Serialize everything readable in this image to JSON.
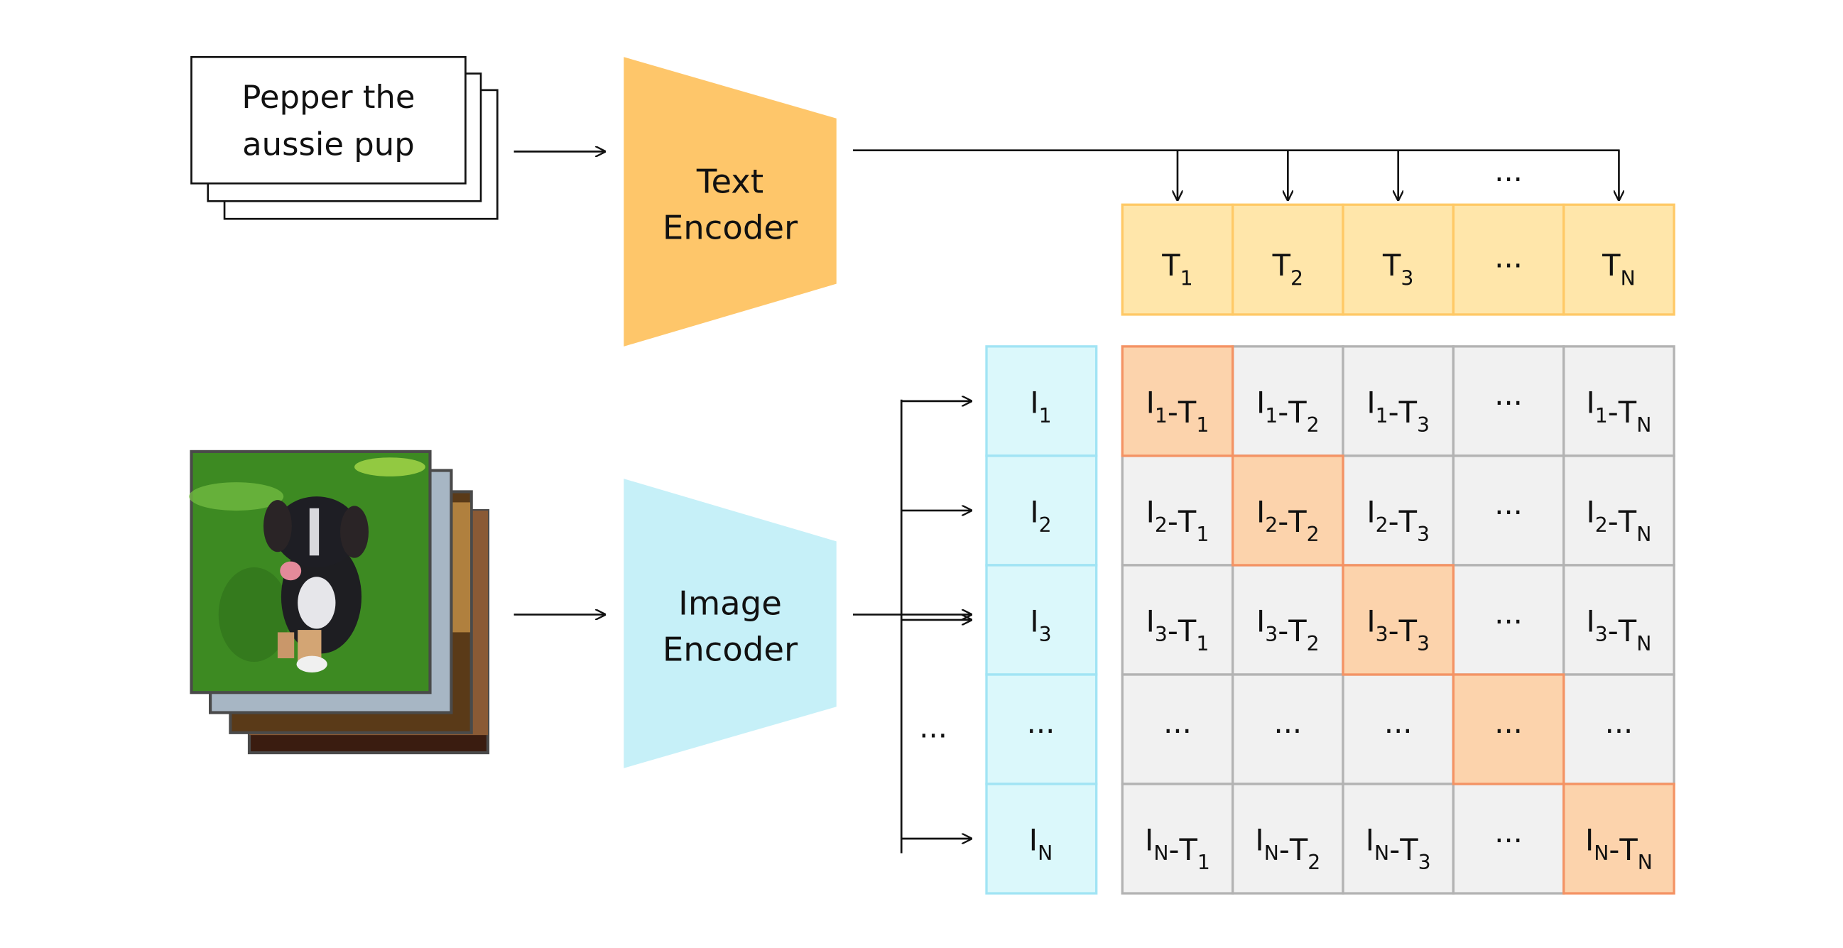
{
  "text_input": {
    "caption_line1": "Pepper the",
    "caption_line2": "aussie pup"
  },
  "text_encoder": {
    "line1": "Text",
    "line2": "Encoder",
    "color": "#FEC66A"
  },
  "image_encoder": {
    "line1": "Image",
    "line2": "Encoder",
    "color": "#C6F0F8"
  },
  "ellipsis": "...",
  "text_embeddings": {
    "fill": "#FFE6AA",
    "stroke": "#FFC966",
    "items": [
      {
        "base": "T",
        "sub": "1"
      },
      {
        "base": "T",
        "sub": "2"
      },
      {
        "base": "T",
        "sub": "3"
      },
      {
        "base": "...",
        "sub": ""
      },
      {
        "base": "T",
        "sub": "N"
      }
    ]
  },
  "image_embeddings": {
    "fill": "#DBF8FB",
    "stroke": "#A1E4F4",
    "items": [
      {
        "base": "I",
        "sub": "1"
      },
      {
        "base": "I",
        "sub": "2"
      },
      {
        "base": "I",
        "sub": "3"
      },
      {
        "base": "...",
        "sub": ""
      },
      {
        "base": "I",
        "sub": "N"
      }
    ]
  },
  "similarity_matrix": {
    "cell_fill": "#F1F1F1",
    "cell_stroke": "#B3B3B3",
    "diag_fill": "#FCD3AC",
    "diag_stroke": "#F49364",
    "row_subs": [
      "1",
      "2",
      "3",
      "...",
      "N"
    ],
    "col_subs": [
      "1",
      "2",
      "3",
      "...",
      "N"
    ]
  }
}
